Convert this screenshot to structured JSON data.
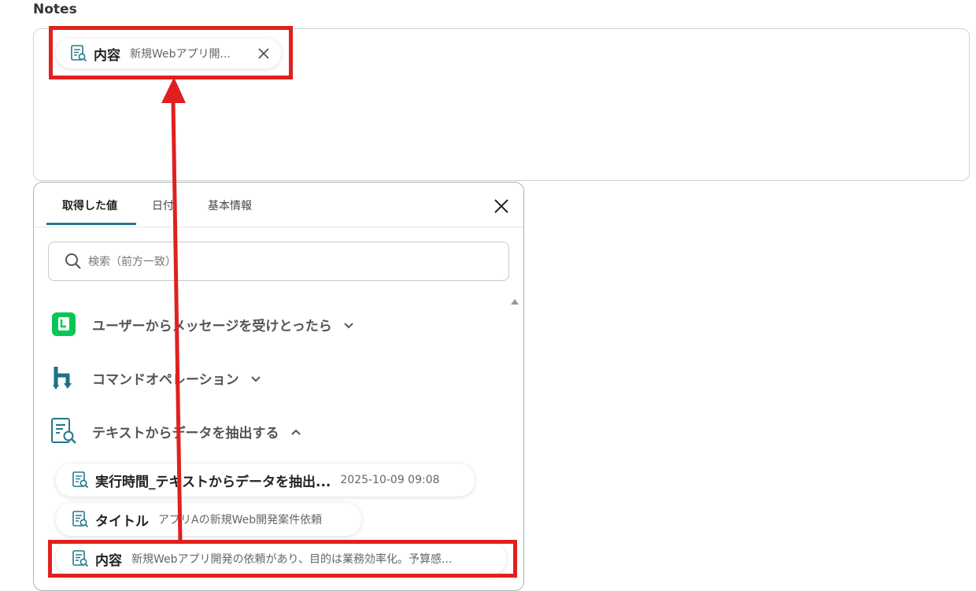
{
  "notes": {
    "label": "Notes",
    "chip": {
      "name": "内容",
      "value": "新規Webアプリ開..."
    }
  },
  "panel": {
    "tabs": [
      {
        "label": "取得した値",
        "active": true
      },
      {
        "label": "日付",
        "active": false
      },
      {
        "label": "基本情報",
        "active": false
      }
    ],
    "search": {
      "placeholder": "検索（前方一致）",
      "value": ""
    },
    "groups": [
      {
        "icon": "line-app-icon",
        "label": "ユーザーからメッセージを受けとったら",
        "expanded": false
      },
      {
        "icon": "command-operation-icon",
        "label": "コマンドオペレーション",
        "expanded": false
      },
      {
        "icon": "document-search-icon",
        "label": "テキストからデータを抽出する",
        "expanded": true
      }
    ],
    "items": [
      {
        "name": "実行時間_テキストからデータを抽出...",
        "value": "2025-10-09 09:08"
      },
      {
        "name": "タイトル",
        "value": "アプリAの新規Web開発案件依頼"
      },
      {
        "name": "内容",
        "value": "新規Webアプリ開発の依頼があり、目的は業務効率化。予算感..."
      }
    ]
  },
  "colors": {
    "accent": "#24798d",
    "highlight": "#e02020",
    "line_green": "#06c755"
  }
}
